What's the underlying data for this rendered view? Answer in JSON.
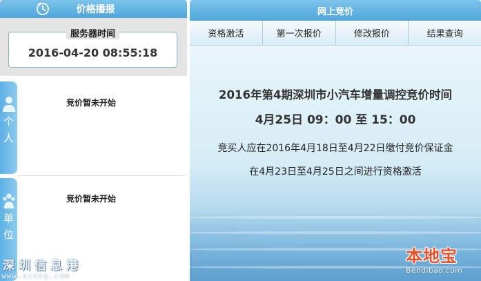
{
  "left_panel": {
    "header_title": "价格播报",
    "server_time_label": "服务器时间",
    "server_time_value": "2016-04-20 08:55:18",
    "tabs": [
      {
        "chars": [
          "个",
          "人"
        ],
        "status": "竞价暂未开始"
      },
      {
        "chars": [
          "单",
          "位"
        ],
        "status": "竞价暂未开始"
      }
    ]
  },
  "right_panel": {
    "header_title": "网上竞价",
    "tabs": [
      {
        "label": "资格激活"
      },
      {
        "label": "第一次报价"
      },
      {
        "label": "修改报价"
      },
      {
        "label": "结果查询"
      }
    ],
    "notice": {
      "title": "2016年第4期深圳市小汽车增量调控竞价时间",
      "time": "4月25日 09：00 至 15：00",
      "line1": "竞买人应在2016年4月18日至4月22日缴付竞价保证金",
      "line2": "在4月23日至4月25日之间进行资格激活"
    }
  },
  "watermarks": {
    "left_cn": "深圳信息港",
    "left_url": "www.szxxg.com",
    "right_brand": "本地宝",
    "right_url": "Bendibao.com"
  },
  "colors": {
    "header_blue": "#5aafe0",
    "tab_blue": "#6dbbea",
    "brand_orange": "#e8502a"
  }
}
